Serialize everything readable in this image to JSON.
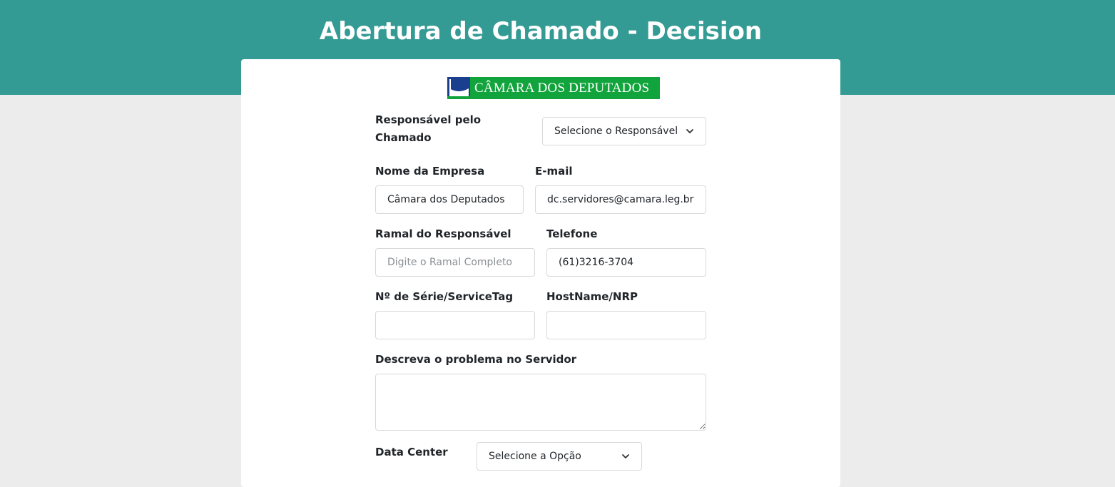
{
  "header": {
    "title": "Abertura de Chamado - Decision"
  },
  "logo": {
    "text": "CÂMARA DOS DEPUTADOS",
    "bg_color": "#12a43c"
  },
  "colors": {
    "header_bg": "#339a94",
    "page_bg": "#ececec"
  },
  "form": {
    "responsavel": {
      "label": "Responsável pelo\nChamado",
      "selected": "Selecione o Responsável",
      "icon": "chevron-down-icon"
    },
    "empresa": {
      "label": "Nome da Empresa",
      "value": "Câmara dos Deputados"
    },
    "email": {
      "label": "E-mail",
      "value": "dc.servidores@camara.leg.br"
    },
    "ramal": {
      "label": "Ramal do Responsável",
      "placeholder": "Digite o Ramal Completo",
      "value": ""
    },
    "telefone": {
      "label": "Telefone",
      "value": "(61)3216-3704"
    },
    "serie": {
      "label": "Nº de Série/ServiceTag",
      "value": ""
    },
    "hostname": {
      "label": "HostName/NRP",
      "value": ""
    },
    "descricao": {
      "label": "Descreva o problema no Servidor",
      "value": ""
    },
    "datacenter": {
      "label": "Data Center",
      "selected": "Selecione a Opção"
    }
  }
}
